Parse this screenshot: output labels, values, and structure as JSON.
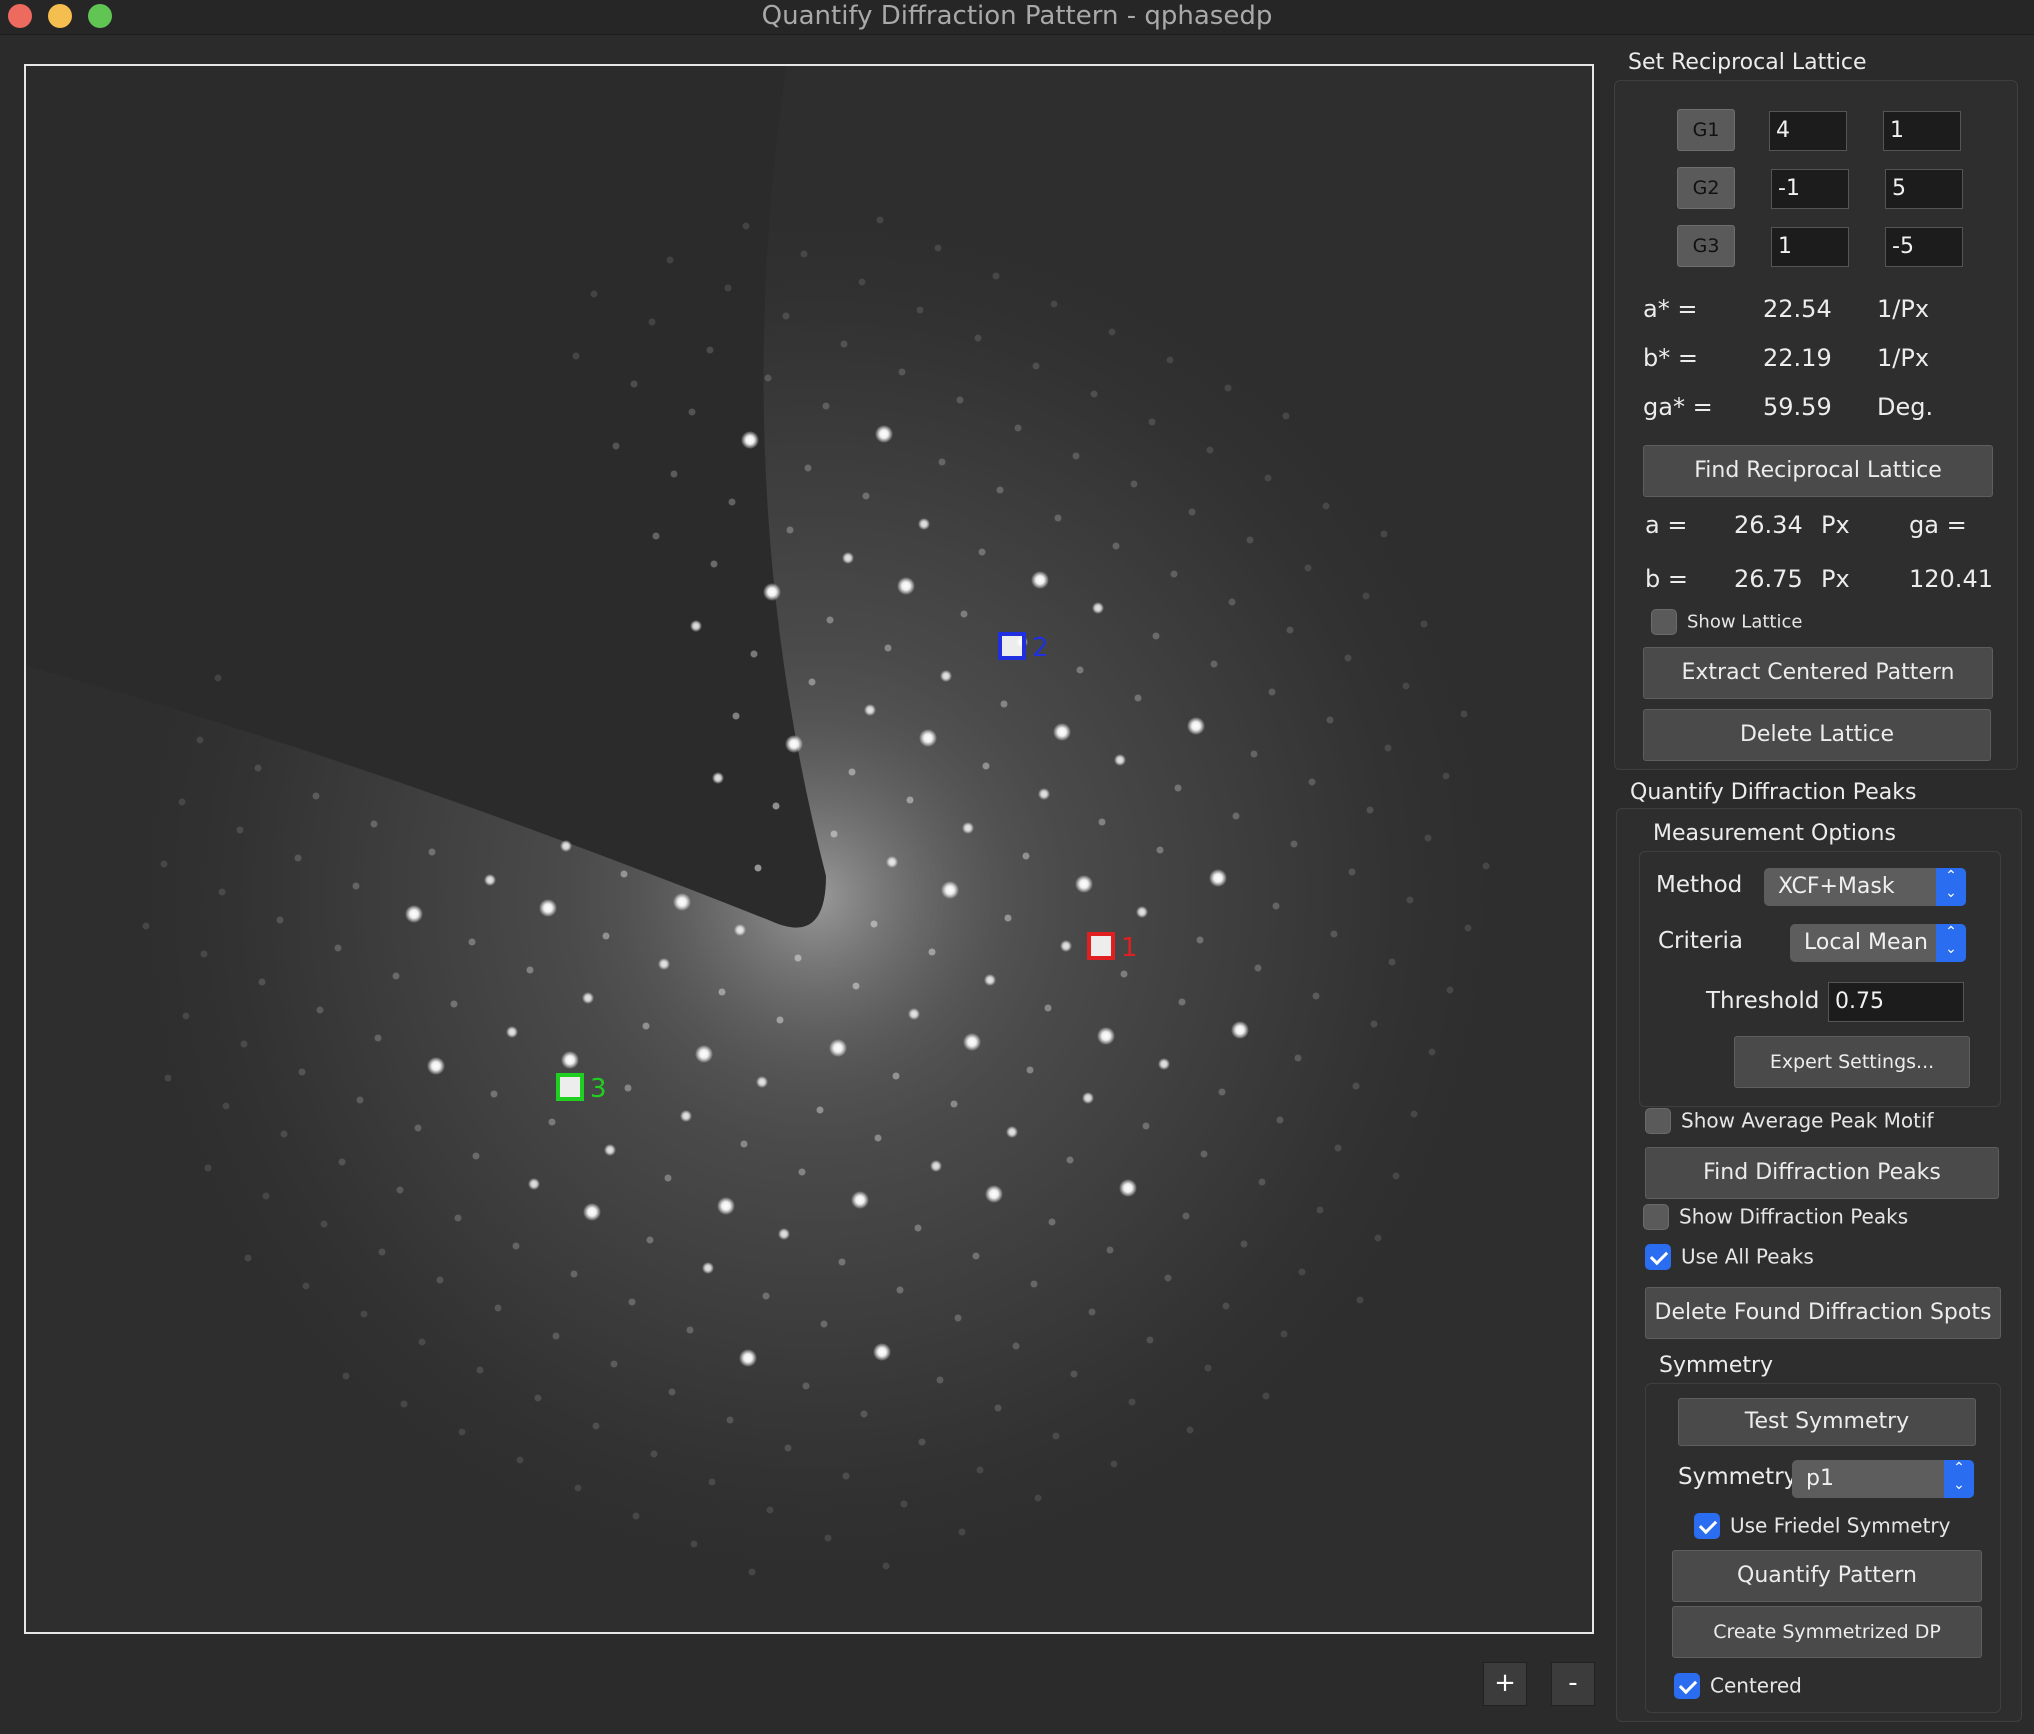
{
  "window": {
    "title": "Quantify Diffraction Pattern - qphasedp"
  },
  "viewer": {
    "markers": [
      {
        "label": "1",
        "color": "#e02020"
      },
      {
        "label": "2",
        "color": "#2030e0"
      },
      {
        "label": "3",
        "color": "#20d020"
      }
    ],
    "zoom_in": "+",
    "zoom_out": "-"
  },
  "lattice": {
    "title": "Set Reciprocal Lattice",
    "g_rows": [
      {
        "label": "G1",
        "v1": "4",
        "v2": "1"
      },
      {
        "label": "G2",
        "v1": "-1",
        "v2": "5"
      },
      {
        "label": "G3",
        "v1": "1",
        "v2": "-5"
      }
    ],
    "reciprocal": [
      {
        "name": "a* =",
        "value": "22.54",
        "unit": "1/Px"
      },
      {
        "name": "b* =",
        "value": "22.19",
        "unit": "1/Px"
      },
      {
        "name": "ga* =",
        "value": "59.59",
        "unit": "Deg."
      }
    ],
    "find_button": "Find Reciprocal Lattice",
    "real": {
      "a_label": "a =",
      "a_value": "26.34",
      "a_unit": "Px",
      "b_label": "b =",
      "b_value": "26.75",
      "b_unit": "Px",
      "ga_label": "ga =",
      "ga_value": "120.41"
    },
    "show_lattice": "Show Lattice",
    "extract_button": "Extract Centered Pattern",
    "delete_button": "Delete Lattice"
  },
  "peaks": {
    "title": "Quantify Diffraction Peaks",
    "options_title": "Measurement Options",
    "method_label": "Method",
    "method_value": "XCF+Mask",
    "criteria_label": "Criteria",
    "criteria_value": "Local Mean",
    "threshold_label": "Threshold",
    "threshold_value": "0.75",
    "expert_button": "Expert Settings...",
    "show_motif": "Show Average Peak Motif",
    "find_button": "Find Diffraction Peaks",
    "show_peaks": "Show Diffraction Peaks",
    "use_all": "Use All Peaks",
    "delete_button": "Delete Found Diffraction Spots"
  },
  "symmetry": {
    "title": "Symmetry",
    "test_button": "Test Symmetry",
    "sym_label": "Symmetry",
    "sym_value": "p1",
    "friedel": "Use Friedel Symmetry",
    "quantify_button": "Quantify Pattern",
    "create_button": "Create Symmetrized DP",
    "centered": "Centered"
  },
  "checks": {
    "show_lattice": false,
    "show_motif": false,
    "show_peaks": false,
    "use_all": true,
    "friedel": true,
    "centered": true
  }
}
